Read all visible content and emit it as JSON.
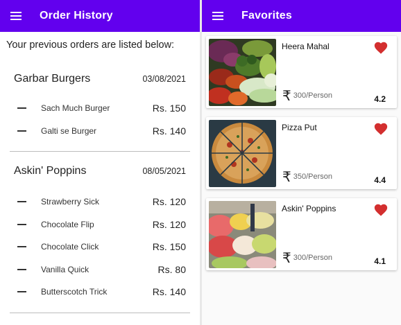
{
  "order_history": {
    "title": "Order History",
    "intro": "Your previous orders are listed below:",
    "orders": [
      {
        "restaurant": "Garbar Burgers",
        "date": "03/08/2021",
        "items": [
          {
            "name": "Sach Much Burger",
            "price": "Rs. 150"
          },
          {
            "name": "Galti se Burger",
            "price": "Rs. 140"
          }
        ]
      },
      {
        "restaurant": "Askin' Poppins",
        "date": "08/05/2021",
        "items": [
          {
            "name": "Strawberry Sick",
            "price": "Rs. 120"
          },
          {
            "name": "Chocolate Flip",
            "price": "Rs. 120"
          },
          {
            "name": "Chocolate Click",
            "price": "Rs. 150"
          },
          {
            "name": "Vanilla Quick",
            "price": "Rs. 80"
          },
          {
            "name": "Butterscotch Trick",
            "price": "Rs. 140"
          }
        ]
      }
    ]
  },
  "favorites": {
    "title": "Favorites",
    "items": [
      {
        "name": "Heera Mahal",
        "price": "300/Person",
        "rating": "4.2",
        "image": "vegetables-photo"
      },
      {
        "name": "Pizza Put",
        "price": "350/Person",
        "rating": "4.4",
        "image": "pizza-photo"
      },
      {
        "name": "Askin' Poppins",
        "price": "300/Person",
        "rating": "4.1",
        "image": "ice-cream-photo"
      }
    ]
  },
  "icons": {
    "menu": "menu-icon",
    "favorite": "heart-icon",
    "currency": "rupee-icon",
    "currency_glyph": "₹"
  },
  "colors": {
    "app_bar": "#6200ee",
    "heart": "#d32f2f"
  }
}
